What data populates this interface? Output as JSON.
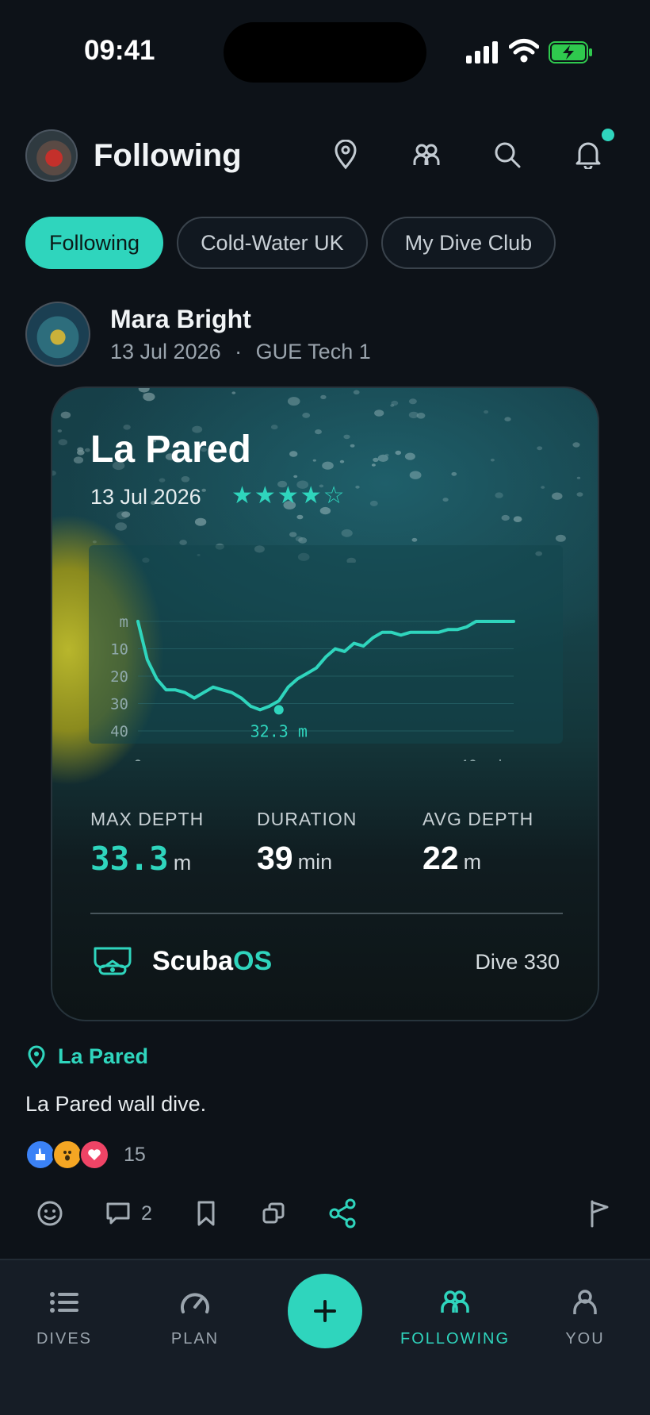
{
  "status_bar": {
    "time": "09:41"
  },
  "header": {
    "title": "Following"
  },
  "chips": [
    "Following",
    "Cold-Water UK",
    "My Dive Club"
  ],
  "post": {
    "author": "Mara Bright",
    "date": "13 Jul 2026",
    "separator": "·",
    "course": "GUE Tech 1",
    "location": "La Pared",
    "caption": "La Pared wall dive.",
    "reaction_count": "15",
    "comment_count": "2"
  },
  "card": {
    "title": "La Pared",
    "date": "13 Jul 2026",
    "rating": 4,
    "rating_max": 5,
    "stats": {
      "max_depth_label": "MAX DEPTH",
      "max_depth_value": "33.3",
      "max_depth_unit": "m",
      "duration_label": "DURATION",
      "duration_value": "39",
      "duration_unit": "min",
      "avg_depth_label": "AVG DEPTH",
      "avg_depth_value": "22",
      "avg_depth_unit": "m"
    },
    "brand_a": "Scuba",
    "brand_b": "OS",
    "dive_number": "Dive 330"
  },
  "chart_data": {
    "type": "line",
    "ylabel": "m",
    "y_ticks": [
      "10",
      "20",
      "30",
      "40"
    ],
    "x_tick_labels": [
      "0",
      "40 min"
    ],
    "ylim": [
      0,
      40
    ],
    "xlim": [
      0,
      40
    ],
    "y_inverted": true,
    "annotation": "32.3 m",
    "annotation_point": {
      "x": 15,
      "y": 32.3
    },
    "series": [
      {
        "x": [
          0,
          1,
          2,
          3,
          4,
          5,
          6,
          7,
          8,
          9,
          10,
          11,
          12,
          13,
          14,
          15,
          16,
          17,
          18,
          19,
          20,
          21,
          22,
          23,
          24,
          25,
          26,
          27,
          28,
          29,
          30,
          31,
          32,
          33,
          34,
          35,
          36,
          37,
          38,
          39,
          40
        ],
        "y": [
          0,
          14,
          21,
          25,
          25,
          26,
          28,
          26,
          24,
          25,
          26,
          28,
          31,
          32.3,
          31,
          29,
          24,
          21,
          19,
          17,
          13,
          10,
          11,
          8,
          9,
          6,
          4,
          4,
          5,
          4,
          4,
          4,
          4,
          3,
          3,
          2,
          0,
          0,
          0,
          0,
          0
        ]
      }
    ],
    "grid": true
  },
  "nav": {
    "dives": "DIVES",
    "plan": "PLAN",
    "following": "FOLLOWING",
    "you": "YOU"
  },
  "colors": {
    "accent": "#2fd5bd",
    "background": "#0d1218",
    "nav_bg": "#161d26"
  }
}
